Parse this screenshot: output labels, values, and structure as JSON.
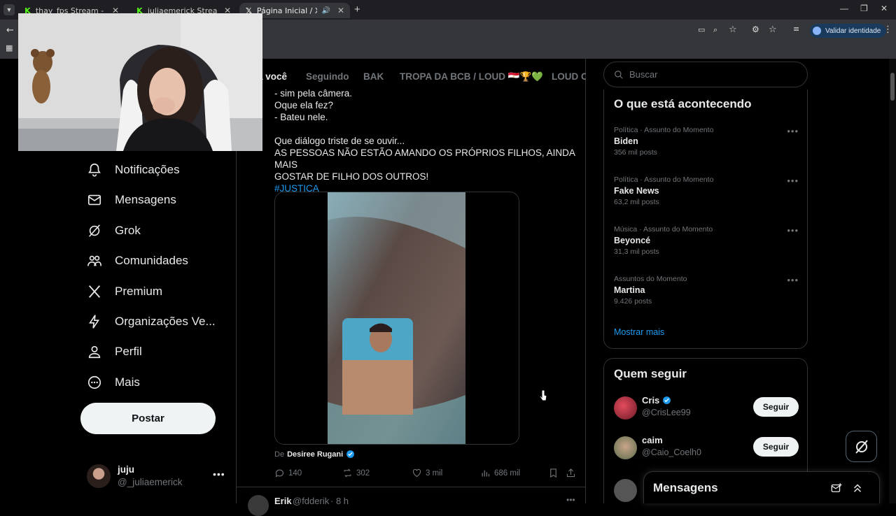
{
  "browser": {
    "tabs": [
      {
        "label": "thay_fps Stream - Watch Live o",
        "icon": "kick-icon"
      },
      {
        "label": "juliaemerick Stream - Watch L",
        "icon": "kick-icon"
      },
      {
        "label": "Página Inicial / X",
        "icon": "x-icon"
      }
    ],
    "validate_label": "Validar identidade"
  },
  "nav": {
    "items": [
      {
        "label": "Notificações",
        "icon": "bell-icon"
      },
      {
        "label": "Mensagens",
        "icon": "mail-icon"
      },
      {
        "label": "Grok",
        "icon": "grok-icon"
      },
      {
        "label": "Comunidades",
        "icon": "communities-icon"
      },
      {
        "label": "Premium",
        "icon": "x-logo-icon"
      },
      {
        "label": "Organizações Ve...",
        "icon": "lightning-icon"
      },
      {
        "label": "Perfil",
        "icon": "person-icon"
      },
      {
        "label": "Mais",
        "icon": "more-circle-icon"
      }
    ],
    "post_label": "Postar",
    "account": {
      "name": "juju",
      "handle": "@_juliaemerick"
    }
  },
  "feed": {
    "tabs": [
      "a você",
      "Seguindo",
      "BAK",
      "TROPA DA BCB / LOUD 🇪🇬🏆💚",
      "LOUD Co"
    ],
    "post_lines": [
      "- sim pela câmera.",
      "Oque ela fez?",
      "- Bateu nele.",
      "",
      "Que diálogo triste de se ouvir...",
      "AS PESSOAS NÃO ESTÃO AMANDO OS PRÓPRIOS FILHOS, AINDA MAIS",
      "GOSTAR DE FILHO DOS OUTROS!"
    ],
    "hashtag": "#JUSTIÇA",
    "from_prefix": "De",
    "from_name": "Desiree Rugani",
    "actions": {
      "replies": "140",
      "reposts": "302",
      "likes": "3 mil",
      "views": "686 mil"
    },
    "next_post": {
      "name": "Erik",
      "handle": "@fdderik",
      "time": "· 8 h"
    }
  },
  "sidebar": {
    "search_placeholder": "Buscar",
    "trends_title": "O que está acontecendo",
    "trends": [
      {
        "category": "Política · Assunto do Momento",
        "name": "Biden",
        "count": "356 mil posts"
      },
      {
        "category": "Política · Assunto do Momento",
        "name": "Fake News",
        "count": "63,2 mil posts"
      },
      {
        "category": "Música · Assunto do Momento",
        "name": "Beyoncé",
        "count": "31,3 mil posts"
      },
      {
        "category": "Assuntos do Momento",
        "name": "Martina",
        "count": "9.426 posts"
      }
    ],
    "show_more": "Mostrar mais",
    "follow_title": "Quem seguir",
    "follow": [
      {
        "name": "Cris",
        "handle": "@CrisLee99",
        "button": "Seguir"
      },
      {
        "name": "caim",
        "handle": "@Caio_Coelh0",
        "button": "Seguir"
      }
    ],
    "messages_label": "Mensagens"
  },
  "colors": {
    "accent": "#1d9bf0",
    "background": "#000000",
    "border": "#2f3336",
    "muted": "#71767b"
  }
}
